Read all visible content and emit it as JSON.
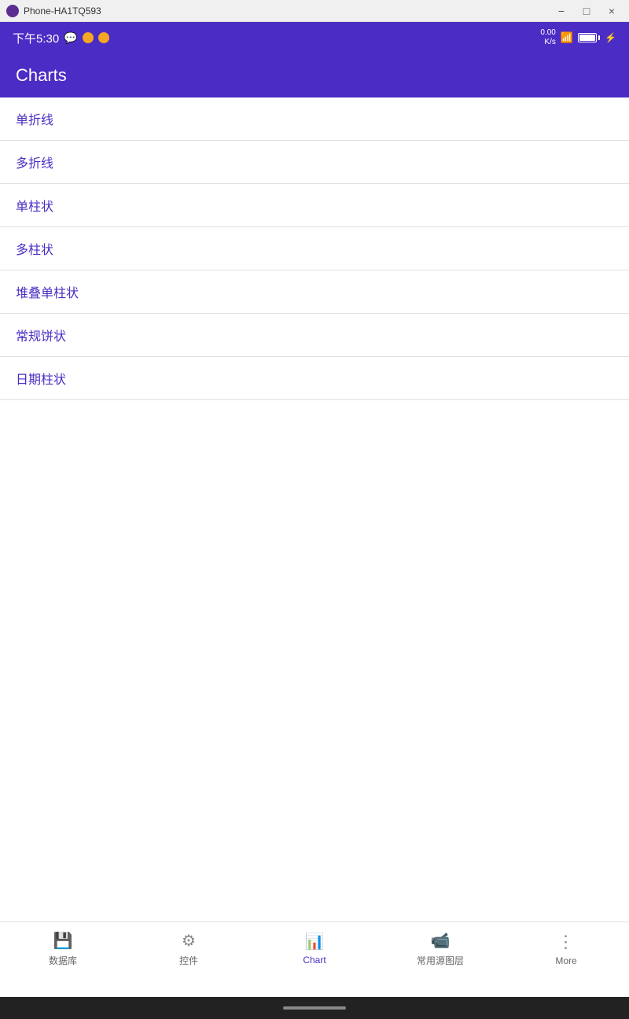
{
  "window": {
    "title": "Phone-HA1TQ593"
  },
  "statusBar": {
    "time": "下午5:30",
    "speed": "0.00\nK/s",
    "battery": "100"
  },
  "header": {
    "title": "Charts"
  },
  "listItems": [
    {
      "id": "single-line",
      "label": "单折线"
    },
    {
      "id": "multi-line",
      "label": "多折线"
    },
    {
      "id": "single-bar",
      "label": "单柱状"
    },
    {
      "id": "multi-bar",
      "label": "多柱状"
    },
    {
      "id": "stacked-bar",
      "label": "堆叠单柱状"
    },
    {
      "id": "pie-chart",
      "label": "常规饼状"
    },
    {
      "id": "date-bar",
      "label": "日期柱状"
    }
  ],
  "bottomNav": {
    "items": [
      {
        "id": "database",
        "label": "数据库",
        "active": false
      },
      {
        "id": "controls",
        "label": "控件",
        "active": false
      },
      {
        "id": "chart",
        "label": "Chart",
        "active": true
      },
      {
        "id": "common-layers",
        "label": "常用源图层",
        "active": false
      },
      {
        "id": "more",
        "label": "More",
        "active": false
      }
    ]
  },
  "colors": {
    "primary": "#4b2cc4",
    "activeNav": "#4b2cc4",
    "inactiveNav": "#666666",
    "listText": "#4b2cc4"
  }
}
